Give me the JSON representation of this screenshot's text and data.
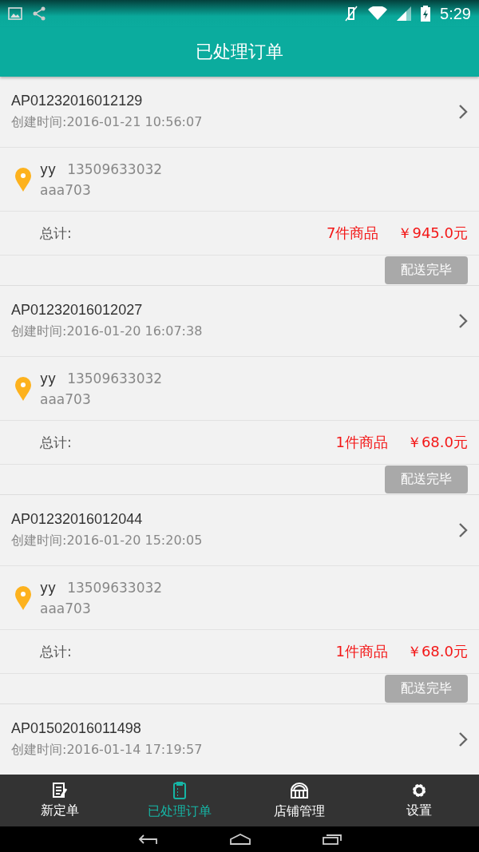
{
  "status_bar": {
    "time": "5:29"
  },
  "app_bar": {
    "title": "已处理订单"
  },
  "orders": [
    {
      "order_no": "AP01232016012129",
      "created": "创建时间:2016-01-21 10:56:07",
      "name": "yy",
      "phone": "13509633032",
      "address": "aaa703",
      "total_label": "总计:",
      "count": "7件商品",
      "amount": "￥945.0元",
      "action": {
        "label": "配送完毕",
        "disabled": true
      }
    },
    {
      "order_no": "AP01232016012027",
      "created": "创建时间:2016-01-20 16:07:38",
      "name": "yy",
      "phone": "13509633032",
      "address": "aaa703",
      "total_label": "总计:",
      "count": "1件商品",
      "amount": "￥68.0元",
      "action": {
        "label": "配送完毕",
        "disabled": true
      }
    },
    {
      "order_no": "AP01232016012044",
      "created": "创建时间:2016-01-20 15:20:05",
      "name": "yy",
      "phone": "13509633032",
      "address": "aaa703",
      "total_label": "总计:",
      "count": "1件商品",
      "amount": "￥68.0元",
      "action": {
        "label": "配送完毕",
        "disabled": true
      }
    },
    {
      "order_no": "AP01502016011498",
      "created": "创建时间:2016-01-14 17:19:57"
    }
  ],
  "bottom_nav": [
    {
      "label": "新定单",
      "kind": "edit",
      "selected": false
    },
    {
      "label": "已处理订单",
      "kind": "clipboard",
      "selected": true
    },
    {
      "label": "店铺管理",
      "kind": "store",
      "selected": false
    },
    {
      "label": "设置",
      "kind": "gear",
      "selected": false
    }
  ]
}
